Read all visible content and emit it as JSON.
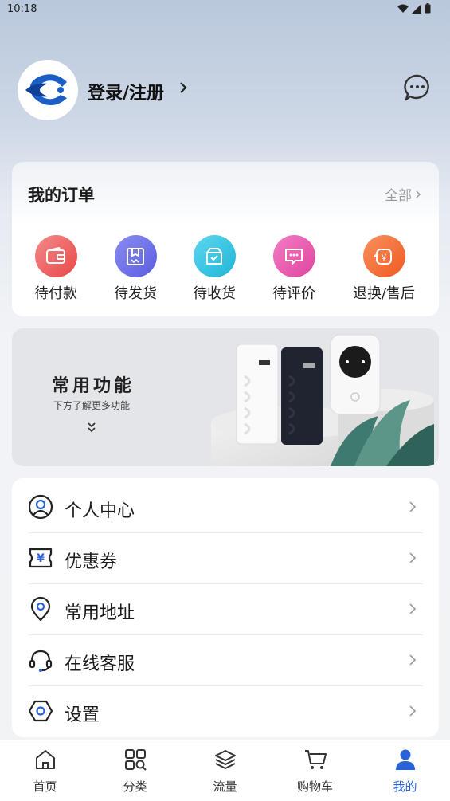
{
  "status_bar": {
    "time": "10:18"
  },
  "profile": {
    "login_label": "登录/注册"
  },
  "orders": {
    "title": "我的订单",
    "all_label": "全部",
    "items": [
      {
        "label": "待付款",
        "icon": "wallet-icon",
        "color": "#ef5a5a"
      },
      {
        "label": "待发货",
        "icon": "package-icon",
        "color": "#6a6de8"
      },
      {
        "label": "待收货",
        "icon": "box-check-icon",
        "color": "#22c2e0"
      },
      {
        "label": "待评价",
        "icon": "comment-icon",
        "color": "#e84fa8"
      },
      {
        "label": "退换/售后",
        "icon": "refund-icon",
        "color": "#f46a2e"
      }
    ]
  },
  "banner": {
    "title": "常用功能",
    "subtitle": "下方了解更多功能"
  },
  "menu": {
    "items": [
      {
        "label": "个人中心",
        "icon": "user-circle-icon"
      },
      {
        "label": "优惠券",
        "icon": "coupon-icon"
      },
      {
        "label": "常用地址",
        "icon": "location-pin-icon"
      },
      {
        "label": "在线客服",
        "icon": "headset-icon"
      },
      {
        "label": "设置",
        "icon": "settings-icon"
      }
    ]
  },
  "tabs": [
    {
      "label": "首页",
      "icon": "home-icon"
    },
    {
      "label": "分类",
      "icon": "category-icon"
    },
    {
      "label": "流量",
      "icon": "layers-icon"
    },
    {
      "label": "购物车",
      "icon": "cart-icon"
    },
    {
      "label": "我的",
      "icon": "person-icon",
      "active": true
    }
  ],
  "colors": {
    "accent": "#2a62d8",
    "brand_blue": "#1b5fc4"
  }
}
